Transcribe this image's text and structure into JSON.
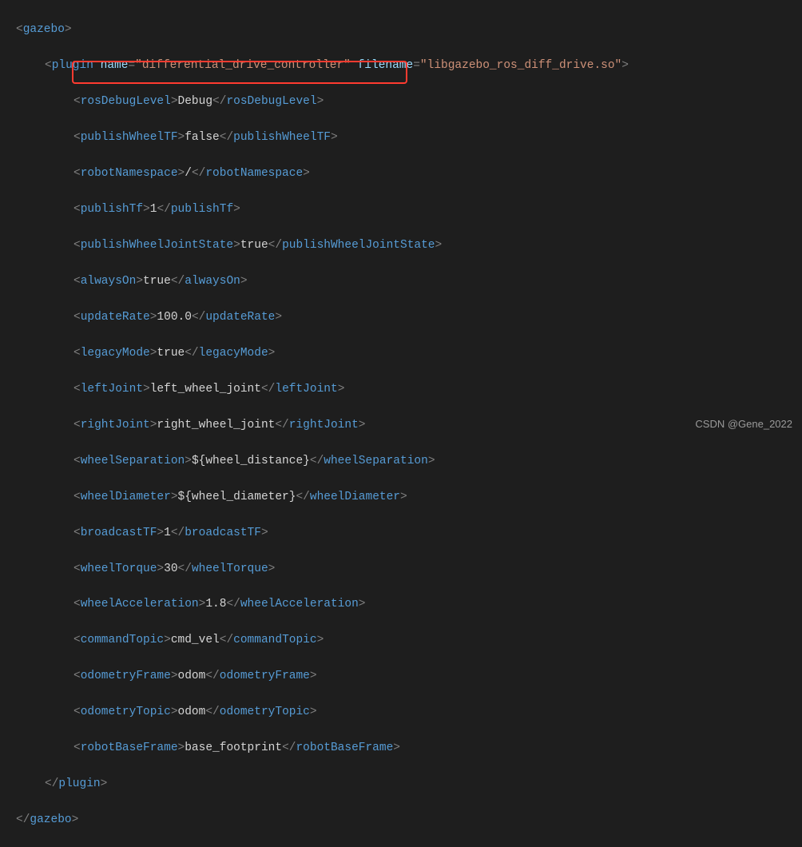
{
  "tags": {
    "gazebo": "gazebo",
    "plugin": "plugin",
    "rosDebugLevel": "rosDebugLevel",
    "publishWheelTF": "publishWheelTF",
    "robotNamespace": "robotNamespace",
    "publishTf": "publishTf",
    "publishWheelJointState": "publishWheelJointState",
    "alwaysOn": "alwaysOn",
    "updateRate": "updateRate",
    "legacyMode": "legacyMode",
    "leftJoint": "leftJoint",
    "rightJoint": "rightJoint",
    "wheelSeparation": "wheelSeparation",
    "wheelDiameter": "wheelDiameter",
    "broadcastTF": "broadcastTF",
    "wheelTorque": "wheelTorque",
    "wheelAcceleration": "wheelAcceleration",
    "commandTopic": "commandTopic",
    "odometryFrame": "odometryFrame",
    "odometryTopic": "odometryTopic",
    "robotBaseFrame": "robotBaseFrame"
  },
  "attrs": {
    "name": "name",
    "filename": "filename"
  },
  "vals": {
    "plugin_name": "\"differential_drive_controller\"",
    "plugin_filename": "\"libgazebo_ros_diff_drive.so\"",
    "rosDebugLevel": "Debug",
    "publishWheelTF": "false",
    "robotNamespace": "/",
    "publishTf": "1",
    "publishWheelJointState": "true",
    "alwaysOn": "true",
    "updateRate": "100.0",
    "legacyMode": "true",
    "leftJoint": "left_wheel_joint",
    "rightJoint": "right_wheel_joint",
    "wheelSeparation": "${wheel_distance}",
    "wheelDiameter": "${wheel_diameter}",
    "broadcastTF": "1",
    "wheelTorque": "30",
    "wheelAcceleration": "1.8",
    "commandTopic": "cmd_vel",
    "odometryFrame": "odom",
    "odometryTopic": "odom",
    "robotBaseFrame": "base_footprint"
  },
  "watermark": "CSDN @Gene_2022"
}
